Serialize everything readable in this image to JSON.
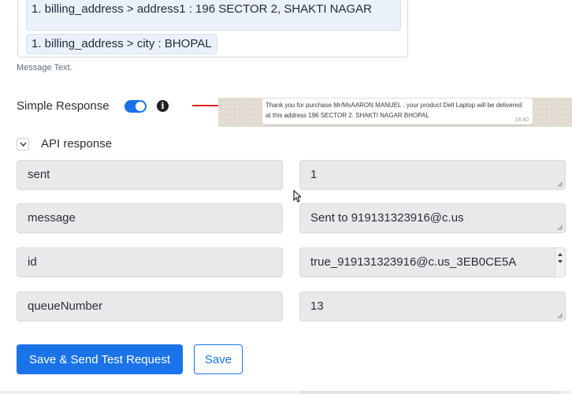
{
  "message": {
    "address_chip": "1. billing_address > address1 : 196 SECTOR 2, SHAKTI NAGAR",
    "city_chip": "1. billing_address > city : BHOPAL",
    "label": "Message Text."
  },
  "simple_response": {
    "label": "Simple Response",
    "enabled": true,
    "info_glyph": "i",
    "preview_text": "Thank you for purchase Mr/MsAARON MANUEL . your product Dell Laptop will be delivered at this address 196 SECTOR 2. SHAKTI NAGAR BHOPAL",
    "preview_time": "18:40"
  },
  "api_response": {
    "label": "API response",
    "rows": [
      {
        "key": "sent",
        "value": "1"
      },
      {
        "key": "message",
        "value": "Sent to 919131323916@c.us"
      },
      {
        "key": "id",
        "value": "true_919131323916@c.us_3EB0CE5A"
      },
      {
        "key": "queueNumber",
        "value": "13"
      }
    ]
  },
  "buttons": {
    "primary": "Save & Send Test Request",
    "secondary": "Save"
  },
  "colors": {
    "accent": "#1a73e8",
    "arrow": "#e02020"
  },
  "icons": {
    "info": "info-icon",
    "collapse": "chevron-down-icon",
    "arrow": "red-arrow-icon"
  }
}
